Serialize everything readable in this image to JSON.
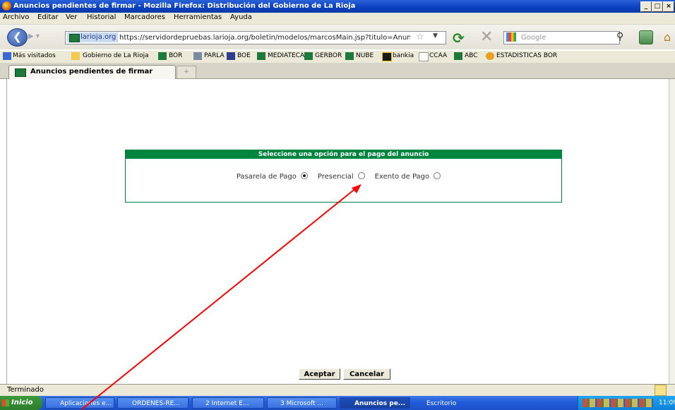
{
  "window": {
    "title": "Anuncios pendientes de firmar - Mozilla Firefox: Distribución del Gobierno de La Rioja",
    "controls": [
      "_",
      "□",
      "×"
    ]
  },
  "menu": [
    "Archivo",
    "Editar",
    "Ver",
    "Historial",
    "Marcadores",
    "Herramientas",
    "Ayuda"
  ],
  "nav": {
    "site_label": "larioja.org",
    "url": "https://servidordepruebas.larioja.org/boletin/modelos/marcosMain.jsp?titulo=Anuncios pendier",
    "search_placeholder": "Google"
  },
  "bookmarks": [
    "Más visitados",
    "Gobierno de La Rioja",
    "BOR",
    "PARLA",
    "BOE",
    "MEDIATECA",
    "GERBOR",
    "NUBE",
    "bankia",
    "CCAA",
    "ABC",
    "ESTADISTICAS BOR"
  ],
  "tab": {
    "title": "Anuncios pendientes de firmar"
  },
  "panel": {
    "header": "Seleccione una opción para el pago del anuncio",
    "options": [
      {
        "label": "Pasarela de Pago",
        "selected": true
      },
      {
        "label": "Presencial",
        "selected": false
      },
      {
        "label": "Exento de Pago",
        "selected": false
      }
    ]
  },
  "buttons": {
    "accept": "Aceptar",
    "cancel": "Cancelar"
  },
  "status": {
    "text": "Terminado"
  },
  "taskbar": {
    "start": "Inicio",
    "tasks": [
      "Aplicaciones e...",
      "ORDENES-RE...",
      "2 Internet E...",
      "3 Microsoft ...",
      "Anuncios pe..."
    ],
    "desktop": "Escritorio",
    "clock": "11:09"
  },
  "colors": {
    "panel_green": "#00853e",
    "arrow_red": "#ff0000",
    "xp_blue": "#245edb"
  }
}
